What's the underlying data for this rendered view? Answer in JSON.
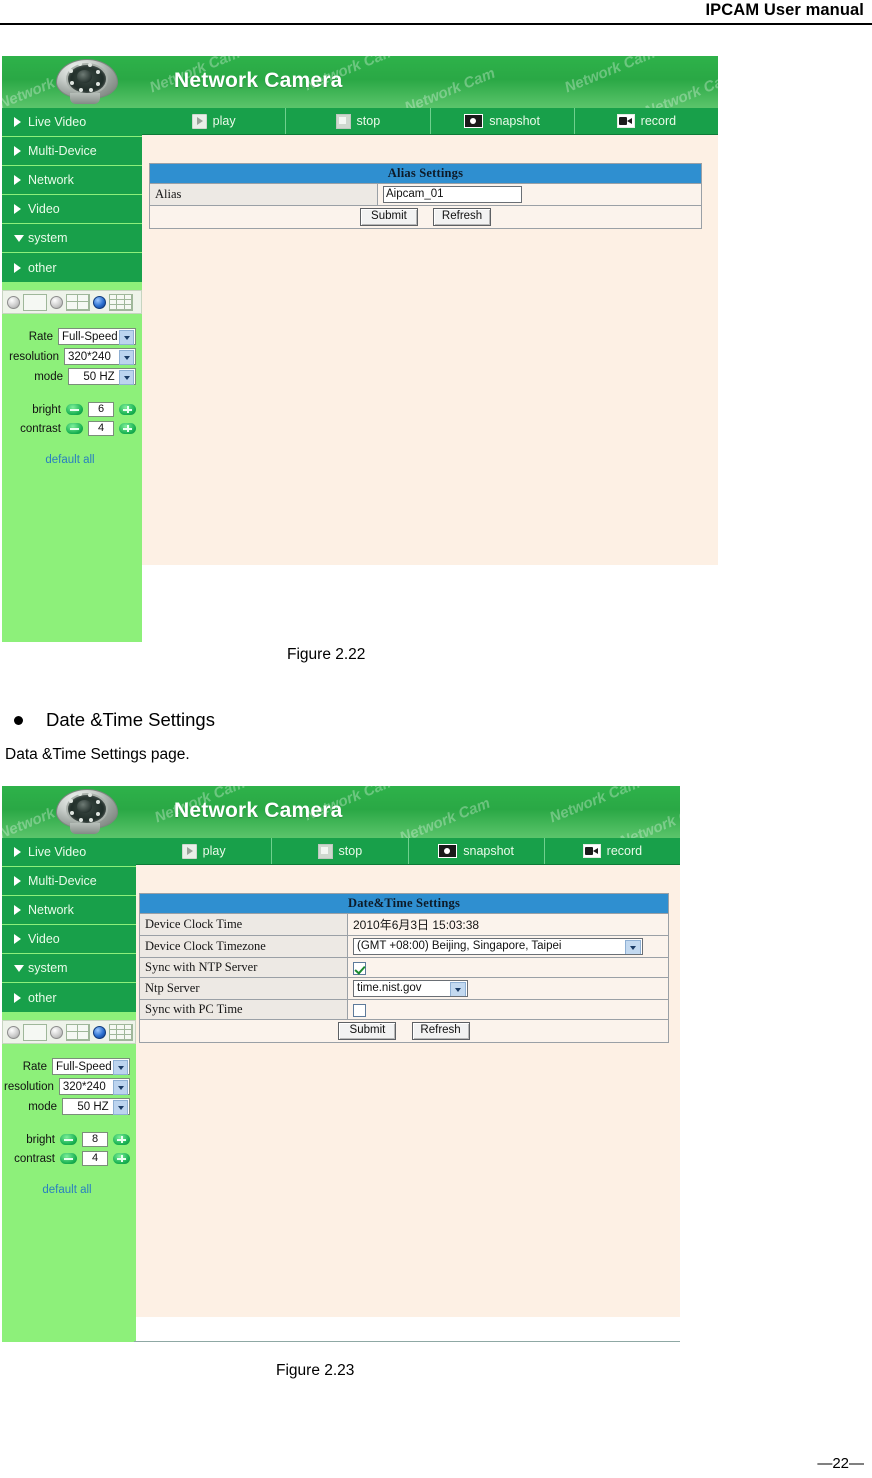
{
  "page": {
    "running_head": "IPCAM User manual",
    "footer": "—22—"
  },
  "figures": [
    {
      "caption": "Figure 2.22",
      "app": {
        "title": "Network Camera",
        "watermark_text": "Network Cam",
        "toolbar": [
          {
            "label": "play",
            "icon": "play-icon"
          },
          {
            "label": "stop",
            "icon": "stop-icon"
          },
          {
            "label": "snapshot",
            "icon": "snapshot-icon"
          },
          {
            "label": "record",
            "icon": "record-icon"
          }
        ],
        "menu": [
          {
            "label": "Live Video",
            "arrow": "right"
          },
          {
            "label": "Multi-Device",
            "arrow": "right"
          },
          {
            "label": "Network",
            "arrow": "right"
          },
          {
            "label": "Video",
            "arrow": "right"
          },
          {
            "label": "system",
            "arrow": "down"
          },
          {
            "label": "other",
            "arrow": "right"
          }
        ],
        "controls": {
          "rate_label": "Rate",
          "rate_value": "Full-Speed",
          "resolution_label": "resolution",
          "resolution_value": "320*240",
          "mode_label": "mode",
          "mode_value": "50 HZ",
          "bright_label": "bright",
          "bright_value": "6",
          "contrast_label": "contrast",
          "contrast_value": "4",
          "default_all_label": "default all"
        },
        "settings": {
          "title": "Alias Settings",
          "rows": [
            {
              "label": "Alias",
              "value": "Aipcam_01",
              "kind": "text"
            }
          ],
          "submit_label": "Submit",
          "refresh_label": "Refresh"
        }
      }
    },
    {
      "caption": "Figure 2.23",
      "app": {
        "title": "Network Camera",
        "watermark_text": "Network Cam",
        "toolbar": [
          {
            "label": "play",
            "icon": "play-icon"
          },
          {
            "label": "stop",
            "icon": "stop-icon"
          },
          {
            "label": "snapshot",
            "icon": "snapshot-icon"
          },
          {
            "label": "record",
            "icon": "record-icon"
          }
        ],
        "menu": [
          {
            "label": "Live Video",
            "arrow": "right"
          },
          {
            "label": "Multi-Device",
            "arrow": "right"
          },
          {
            "label": "Network",
            "arrow": "right"
          },
          {
            "label": "Video",
            "arrow": "right"
          },
          {
            "label": "system",
            "arrow": "down"
          },
          {
            "label": "other",
            "arrow": "right"
          }
        ],
        "controls": {
          "rate_label": "Rate",
          "rate_value": "Full-Speed",
          "resolution_label": "resolution",
          "resolution_value": "320*240",
          "mode_label": "mode",
          "mode_value": "50 HZ",
          "bright_label": "bright",
          "bright_value": "8",
          "contrast_label": "contrast",
          "contrast_value": "4",
          "default_all_label": "default all"
        },
        "settings": {
          "title": "Date&Time Settings",
          "rows": [
            {
              "label": "Device Clock Time",
              "value": "2010年6月3日  15:03:38",
              "kind": "static"
            },
            {
              "label": "Device Clock Timezone",
              "value": "(GMT +08:00) Beijing, Singapore, Taipei",
              "kind": "select"
            },
            {
              "label": "Sync with NTP Server",
              "value": "",
              "kind": "checkbox-on"
            },
            {
              "label": "Ntp Server",
              "value": "time.nist.gov",
              "kind": "select-small"
            },
            {
              "label": "Sync with PC Time",
              "value": "",
              "kind": "checkbox-off"
            }
          ],
          "submit_label": "Submit",
          "refresh_label": "Refresh"
        }
      }
    }
  ],
  "section": {
    "bullet_heading": "Date &Time Settings",
    "body_text": "Data &Time Settings page."
  },
  "colors": {
    "banner_green": "#2aa845",
    "menu_green": "#18a04a",
    "panel_green": "#8df07a",
    "table_header_blue": "#2f8fd0",
    "content_cream": "#fdf0e4",
    "link_blue": "#2a7fc0"
  }
}
